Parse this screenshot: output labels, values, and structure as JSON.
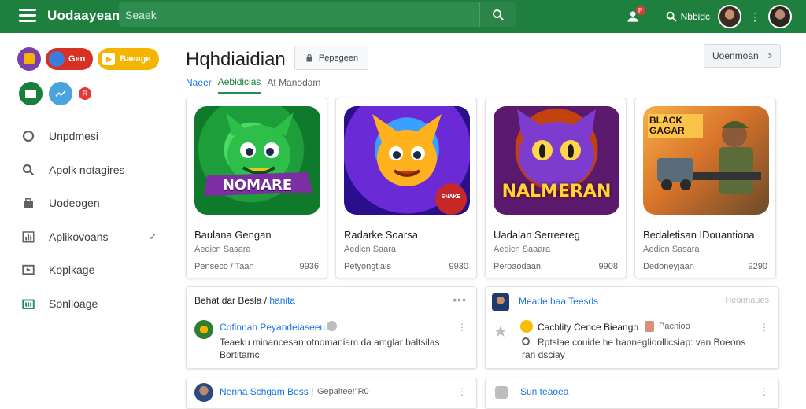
{
  "topbar": {
    "brand": "Uodaayean",
    "search_placeholder": "Seaek",
    "user_label": "Nbbidc",
    "notif_badge": "P",
    "accent": "#1e7f3f"
  },
  "sidebar": {
    "chips": [
      {
        "label": "",
        "color": "#7b3fb0"
      },
      {
        "label": "Gen",
        "color": "#d93025"
      },
      {
        "label": "Baeage",
        "color": "#f4b400"
      }
    ],
    "circles": [
      {
        "color": "#188038"
      },
      {
        "color": "#4aa3df"
      },
      {
        "label": "R",
        "color": "#e53935"
      }
    ],
    "nav": [
      {
        "label": "Unpdmesi",
        "icon": "circle-icon"
      },
      {
        "label": "Apolk notagires",
        "icon": "search-icon"
      },
      {
        "label": "Uodeogen",
        "icon": "bag-icon"
      },
      {
        "label": "Aplikovoans",
        "icon": "chart-icon",
        "check": "✓"
      },
      {
        "label": "Koplkage",
        "icon": "play-icon"
      },
      {
        "label": "Sonlloage",
        "icon": "library-icon"
      }
    ]
  },
  "main": {
    "title": "Hqhdiaidian",
    "title_button": "Pepegeen",
    "right_button": "Uoenmoan",
    "right_chevron": "›",
    "tabs": [
      {
        "label": "Naeer",
        "state": "blue"
      },
      {
        "label": "Aebldiclas",
        "state": "active"
      },
      {
        "label": "At Manodam",
        "state": "normal"
      }
    ],
    "cards": [
      {
        "art_text": "NOMARE",
        "name": "Baulana Gengan",
        "sub": "Aedicn Sasara",
        "meta": "Penseco / Taan",
        "price": "9936"
      },
      {
        "art_text": "SNAKE",
        "name": "Radarke Soarsa",
        "sub": "Aedicn Saara",
        "meta": "Petyongtiais",
        "price": "9930"
      },
      {
        "art_text": "NALMERAN",
        "name": "Uadalan Serreereg",
        "sub": "Aedicn Saaara",
        "meta": "Perpaodaan",
        "price": "9908"
      },
      {
        "art_text": "BLACK GAGAR",
        "name": "Bedaletisan IDouantiona",
        "sub": "Aedicn Sasara",
        "meta": "Dedoneyjaan",
        "price": "9290"
      }
    ],
    "panel_left": {
      "heading": "Behat dar Besla /",
      "heading_link": "hanita",
      "item": {
        "title": "Cofinnah Peyandeiaseeu.",
        "line1": "Teaeku minancesan otnomaniam da amglar baltsilas",
        "line2": "Bortitamc"
      },
      "item2": {
        "title": "Nenha Schgam Bess !",
        "extra": "Gepaitee!\"R0"
      }
    },
    "panel_right": {
      "heading": "Meade haa Teesds",
      "heading_right": "Heoimaues",
      "item": {
        "title": "Cachlity Cence Bieango",
        "tag": "Pacnioo",
        "line1": "Rptslae couide he haoneglioollicsiap: van Boeons",
        "line2": "ran dsciay"
      },
      "item2": {
        "title": "Sun teaoea"
      }
    }
  }
}
